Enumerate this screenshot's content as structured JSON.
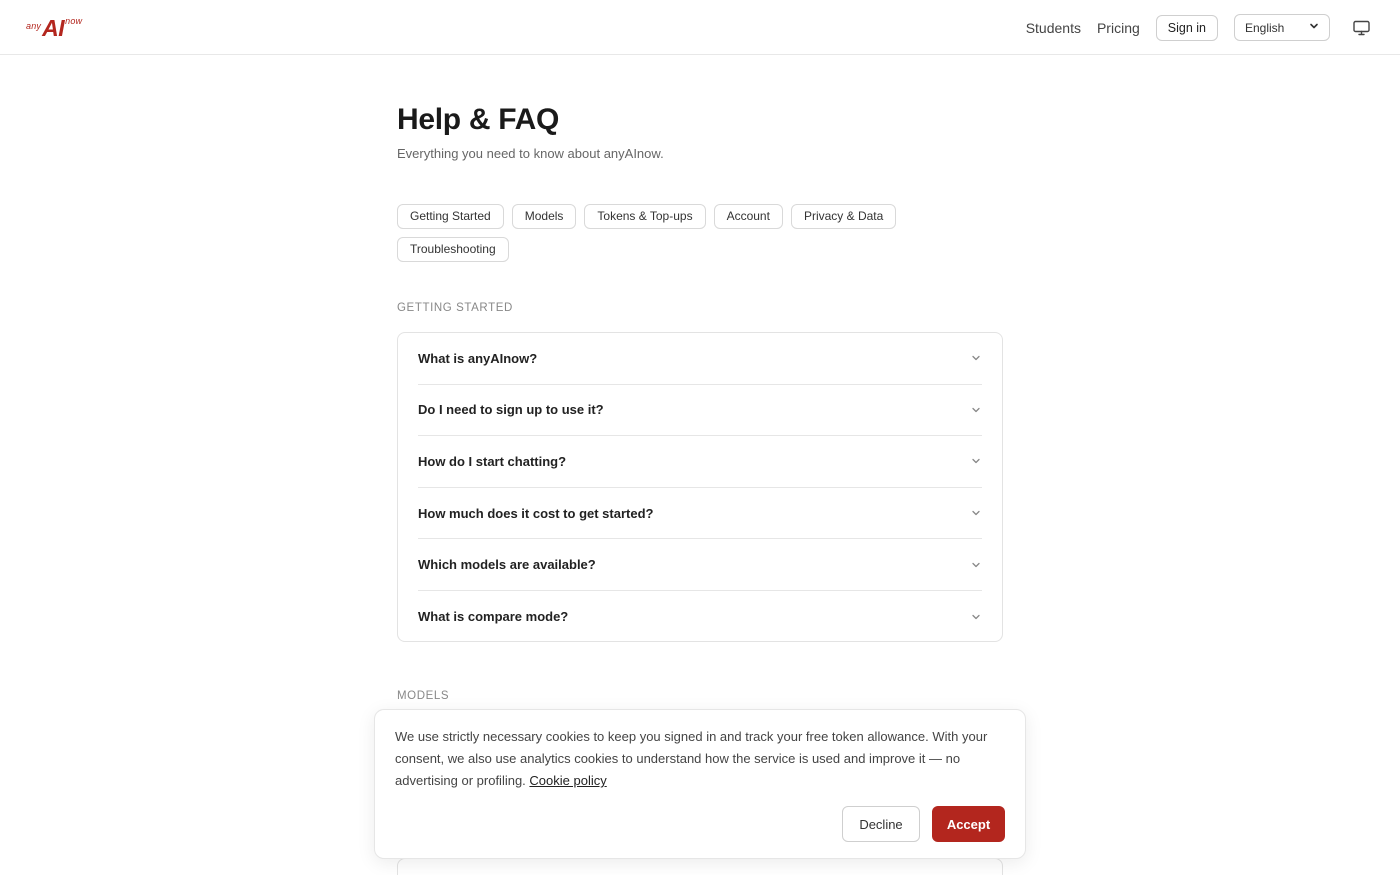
{
  "header": {
    "logo": {
      "prefix": "any",
      "main": "AI",
      "suffix": "now"
    },
    "nav": {
      "students": "Students",
      "pricing": "Pricing",
      "sign_in": "Sign in"
    },
    "language": {
      "selected": "English"
    },
    "theme_icon": "monitor-icon"
  },
  "main": {
    "title": "Help & FAQ",
    "subtitle": "Everything you need to know about anyAInow.",
    "categories": [
      "Getting Started",
      "Models",
      "Tokens & Top-ups",
      "Account",
      "Privacy & Data",
      "Troubleshooting"
    ]
  },
  "sections": [
    {
      "label": "GETTING STARTED",
      "questions": [
        "What is anyAInow?",
        "Do I need to sign up to use it?",
        "How do I start chatting?",
        "How much does it cost to get started?",
        "Which models are available?",
        "What is compare mode?"
      ]
    },
    {
      "label": "MODELS"
    }
  ],
  "cookie_banner": {
    "text": "We use strictly necessary cookies to keep you signed in and track your free token allowance. With your consent, we also use analytics cookies to understand how the service is used and improve it — no advertising or profiling.",
    "link": "Cookie policy",
    "decline": "Decline",
    "accept": "Accept"
  },
  "colors": {
    "brand": "#b3261e",
    "border": "#e3e3e3",
    "text": "#1a1a1a"
  }
}
